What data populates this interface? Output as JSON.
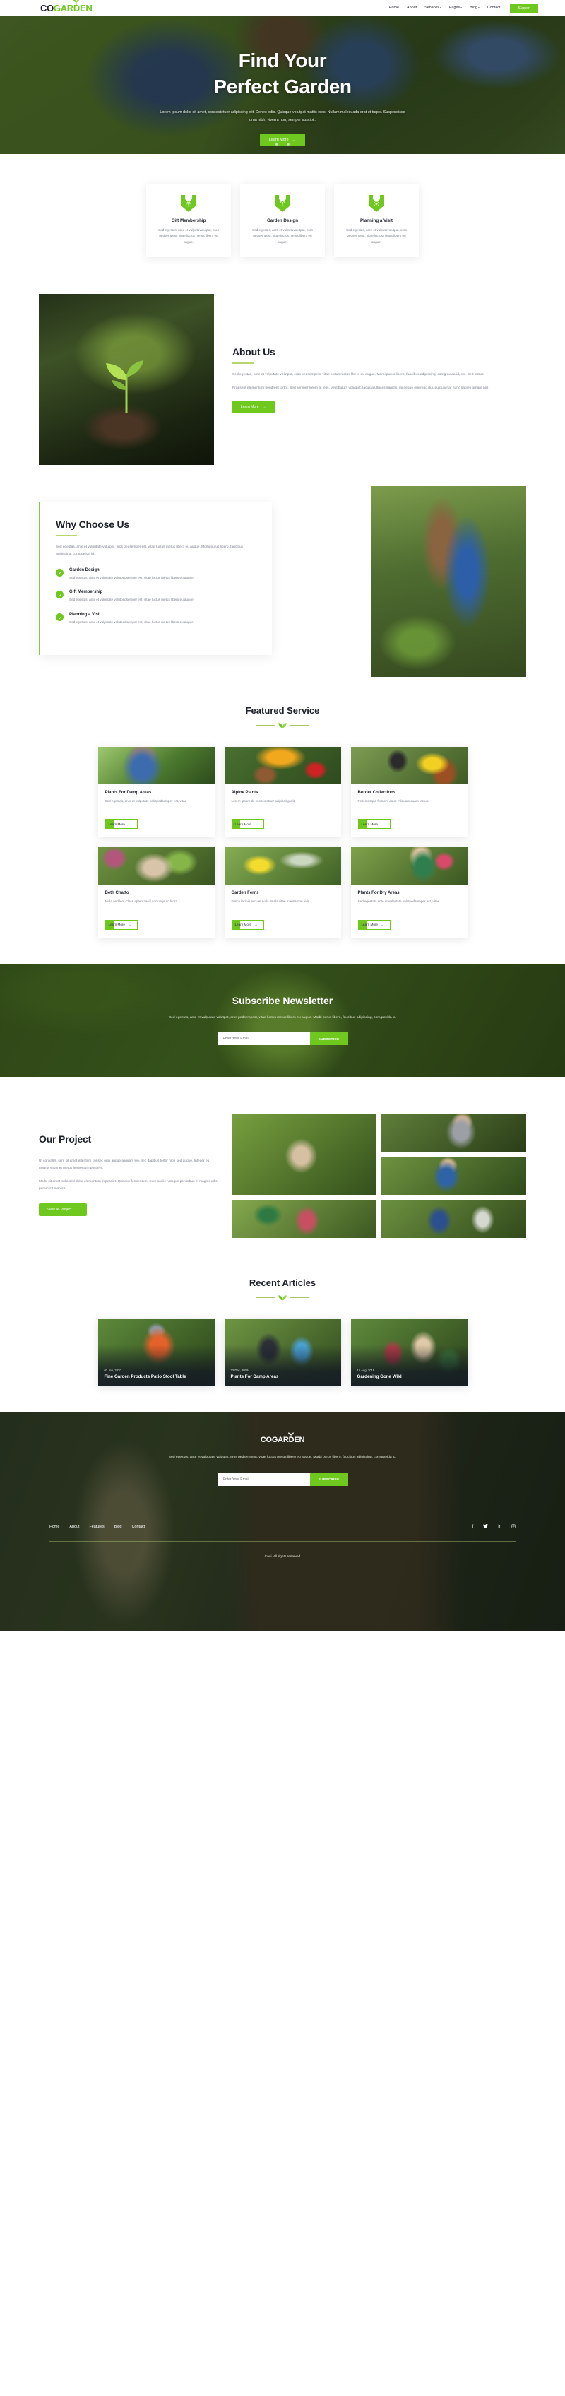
{
  "brand": {
    "part1": "CO",
    "part2": "GARDEN",
    "leaf_icon": "leaf-sprout-icon"
  },
  "header": {
    "nav": [
      {
        "label": "Home",
        "active": true,
        "caret": false
      },
      {
        "label": "About",
        "active": false,
        "caret": false
      },
      {
        "label": "Services",
        "active": false,
        "caret": true
      },
      {
        "label": "Pages",
        "active": false,
        "caret": true
      },
      {
        "label": "Blog",
        "active": false,
        "caret": true
      },
      {
        "label": "Contact",
        "active": false,
        "caret": false
      }
    ],
    "support_button": "Support"
  },
  "hero": {
    "title_line1": "Find Your",
    "title_line2": "Perfect Garden",
    "paragraph": "Lorem ipsum dolor sit amet, consectetuer adipiscing elit. Donec odio. Quisque volutpat mattis eros. Nullam malesuada erat ut turpis. Suspendisse urna nibh, viverra non, semper suscipit.",
    "cta": "Learn More",
    "arrow_icon": "arrow-right-icon",
    "slide_count": 3,
    "active_slide": 2
  },
  "features": [
    {
      "icon": "gift-shield-icon",
      "title": "Gift Membership",
      "text": "Sed egestas, ante et vulputavolutpat, eros pedsempest, vitae luctus metus libero eu augue."
    },
    {
      "icon": "plant-shield-icon",
      "title": "Garden Design",
      "text": "Sed egestas, ante et vulputavolutpat, eros pedsempest, vitae luctus metus libero eu augue."
    },
    {
      "icon": "calendar-shield-icon",
      "title": "Planning a Visit",
      "text": "Sed egestas, ante et vulputavolutpat, eros pedsempest, vitae luctus metus libero eu augue."
    }
  ],
  "about": {
    "image_alt": "sprout-seedling-photo",
    "title": "About Us",
    "p1": "Sed egestas, ante et vulputate volutpat, eros pedsempest, vitae luctus metus libero eu augue. Morbi purus libero, faucibus adipiscing, comgravida id, est. Sed lectus.",
    "p2": "Praesent elementum hendrerit tortor. Sed semper lorem at felis. Vestibulum volutpat, lacus a ultrices sagittis, mi neque euismod dui, eu pulvinar nunc sapien ornare nisl.",
    "cta": "Learn More"
  },
  "why": {
    "title": "Why Choose Us",
    "lead": "Sed egestas, ante et vulputate volutpat, eros pedsemper est, vitae luctus metus libero eu augue. Morbi purus libero, faucibus adipiscing, comgravida id.",
    "items": [
      {
        "check_icon": "check-circle-icon",
        "title": "Garden Design",
        "text": "Sed egestas, ante et vulputate volutpedsemper est, vitae luctus metus libero eu augue."
      },
      {
        "check_icon": "check-circle-icon",
        "title": "Gift Membership",
        "text": "Sed egestas, ante et vulputate volutpedsemper est, vitae luctus metus libero eu augue."
      },
      {
        "check_icon": "check-circle-icon",
        "title": "Planning a Visit",
        "text": "Sed egestas, ante et vulputate volutpedsemper est, vitae luctus metus libero eu augue."
      }
    ],
    "image_alt": "woman-holding-plant-photo"
  },
  "featured": {
    "title": "Featured Service",
    "divider_icon": "leaf-divider-icon",
    "cards": [
      {
        "title": "Plants For Damp Areas",
        "text": "Sed egestas, ante et vulputate volutpedsemper est, vitae",
        "cta": "Learn More"
      },
      {
        "title": "Alpine Plants",
        "text": "Lorem ipsum do consectetuer adipiscing elit.",
        "cta": "Learn More"
      },
      {
        "title": "Border Collections",
        "text": "Pellentesque ferment dolor. Aliquam quam lectus.",
        "cta": "Learn More"
      },
      {
        "title": "Beth Chatto",
        "text": "Nulla sed leo. Class aptent taciti sociosqu ad litora",
        "cta": "Learn More"
      },
      {
        "title": "Garden Ferns",
        "text": "Fusce lacinia arcu et nulla. Nulla vitae mauris non felis",
        "cta": "Learn More"
      },
      {
        "title": "Plants For Dry Areas",
        "text": "Sed egestas, ante et vulputate volutpedsemper est, vitae",
        "cta": "Learn More"
      }
    ]
  },
  "newsletter": {
    "title": "Subscribe Newsletter",
    "text": "Sed egestas, ante et vulputate volutpat, eros pedsempest, vitae luctus metus libero eu augue. Morbi purus libero, faucibus adipiscing, comgravida id.",
    "placeholder": "Enter Your Email",
    "button": "SUBSCRIBE"
  },
  "project": {
    "title": "Our Project",
    "p1": "Ut convallis, sem sit amet interdum consec odio augue aliquam leo, nec dapibus tortor nibh sed augue. Integer eu magna sit amet metus fermentum posuere.",
    "p2": "Morbi sit amet nulla sed dolor elementum imperdiet. Quisque fermentum. Cum sociis natoque penatibus et magnis xdis parturient montes.",
    "cta": "View All Project",
    "images": [
      "hands-planting-photo",
      "man-with-pots-photo",
      "man-gardening-photo",
      "woman-with-plant-photo",
      "people-in-garden-photo"
    ]
  },
  "articles": {
    "title": "Recent Articles",
    "divider_icon": "leaf-divider-icon",
    "cards": [
      {
        "date": "02 Jan, 2020",
        "title": "Fine Garden Products Patio Stool Table"
      },
      {
        "date": "22 Dec, 2019",
        "title": "Plants For Damp Areas"
      },
      {
        "date": "15 Aug, 2019",
        "title": "Gardening Gone Wild"
      }
    ]
  },
  "footer": {
    "text": "Sed egestas, ante et vulputate volutpat, eros pedsempest, vitae luctus metus libero eu augue. Morbi purus libero, faucibus adipiscing, comgravida id.",
    "placeholder": "Enter Your Email",
    "button": "SUBSCRIBE",
    "nav": [
      "Home",
      "About",
      "Features",
      "Blog",
      "Contact"
    ],
    "social": [
      {
        "name": "facebook-icon",
        "glyph": "f"
      },
      {
        "name": "twitter-icon",
        "glyph": "ᵛ"
      },
      {
        "name": "linkedin-icon",
        "glyph": "in"
      },
      {
        "name": "instagram-icon",
        "glyph": "◎"
      }
    ],
    "copyright": "Coui. All rights reserved"
  },
  "colors": {
    "accent": "#6ec81e",
    "dark": "#1d212b",
    "muted": "#7b8190",
    "rule": "#b9d66a"
  }
}
